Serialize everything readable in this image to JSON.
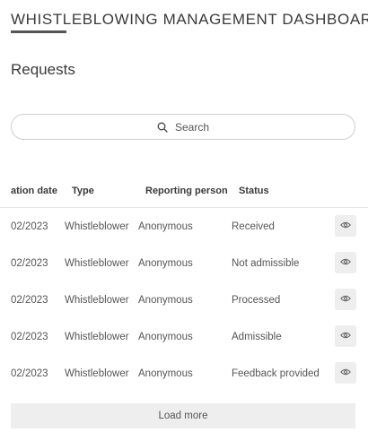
{
  "header": {
    "title": "WHISTLEBLOWING MANAGEMENT DASHBOARD"
  },
  "section": {
    "title": "Requests"
  },
  "search": {
    "placeholder": "Search",
    "icon": "search-icon"
  },
  "table": {
    "columns": [
      "ation date",
      "Type",
      "Reporting person",
      "Status"
    ],
    "rows": [
      {
        "date": "02/2023",
        "type": "Whistleblower",
        "person": "Anonymous",
        "status": "Received"
      },
      {
        "date": "02/2023",
        "type": "Whistleblower",
        "person": "Anonymous",
        "status": "Not admissible"
      },
      {
        "date": "02/2023",
        "type": "Whistleblower",
        "person": "Anonymous",
        "status": "Processed"
      },
      {
        "date": "02/2023",
        "type": "Whistleblower",
        "person": "Anonymous",
        "status": "Admissible"
      },
      {
        "date": "02/2023",
        "type": "Whistleblower",
        "person": "Anonymous",
        "status": "Feedback provided"
      }
    ],
    "row_action_icon": "eye-icon"
  },
  "load_more": {
    "label": "Load more"
  }
}
